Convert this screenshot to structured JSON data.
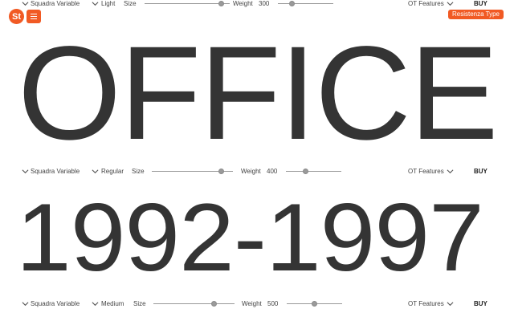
{
  "brand": {
    "logo_text": "St",
    "name": "Resistenza Type"
  },
  "rows": [
    {
      "font": "Squadra Variable",
      "style": "Light",
      "size_label": "Size",
      "weight_label": "Weight",
      "weight_value": "300",
      "ot_label": "OT Features",
      "buy_label": "BUY",
      "specimen": "OFFICE"
    },
    {
      "font": "Squadra Variable",
      "style": "Regular",
      "size_label": "Size",
      "weight_label": "Weight",
      "weight_value": "400",
      "ot_label": "OT Features",
      "buy_label": "BUY",
      "specimen": "1992-1997"
    },
    {
      "font": "Squadra Variable",
      "style": "Medium",
      "size_label": "Size",
      "weight_label": "Weight",
      "weight_value": "500",
      "ot_label": "OT Features",
      "buy_label": "BUY"
    }
  ]
}
